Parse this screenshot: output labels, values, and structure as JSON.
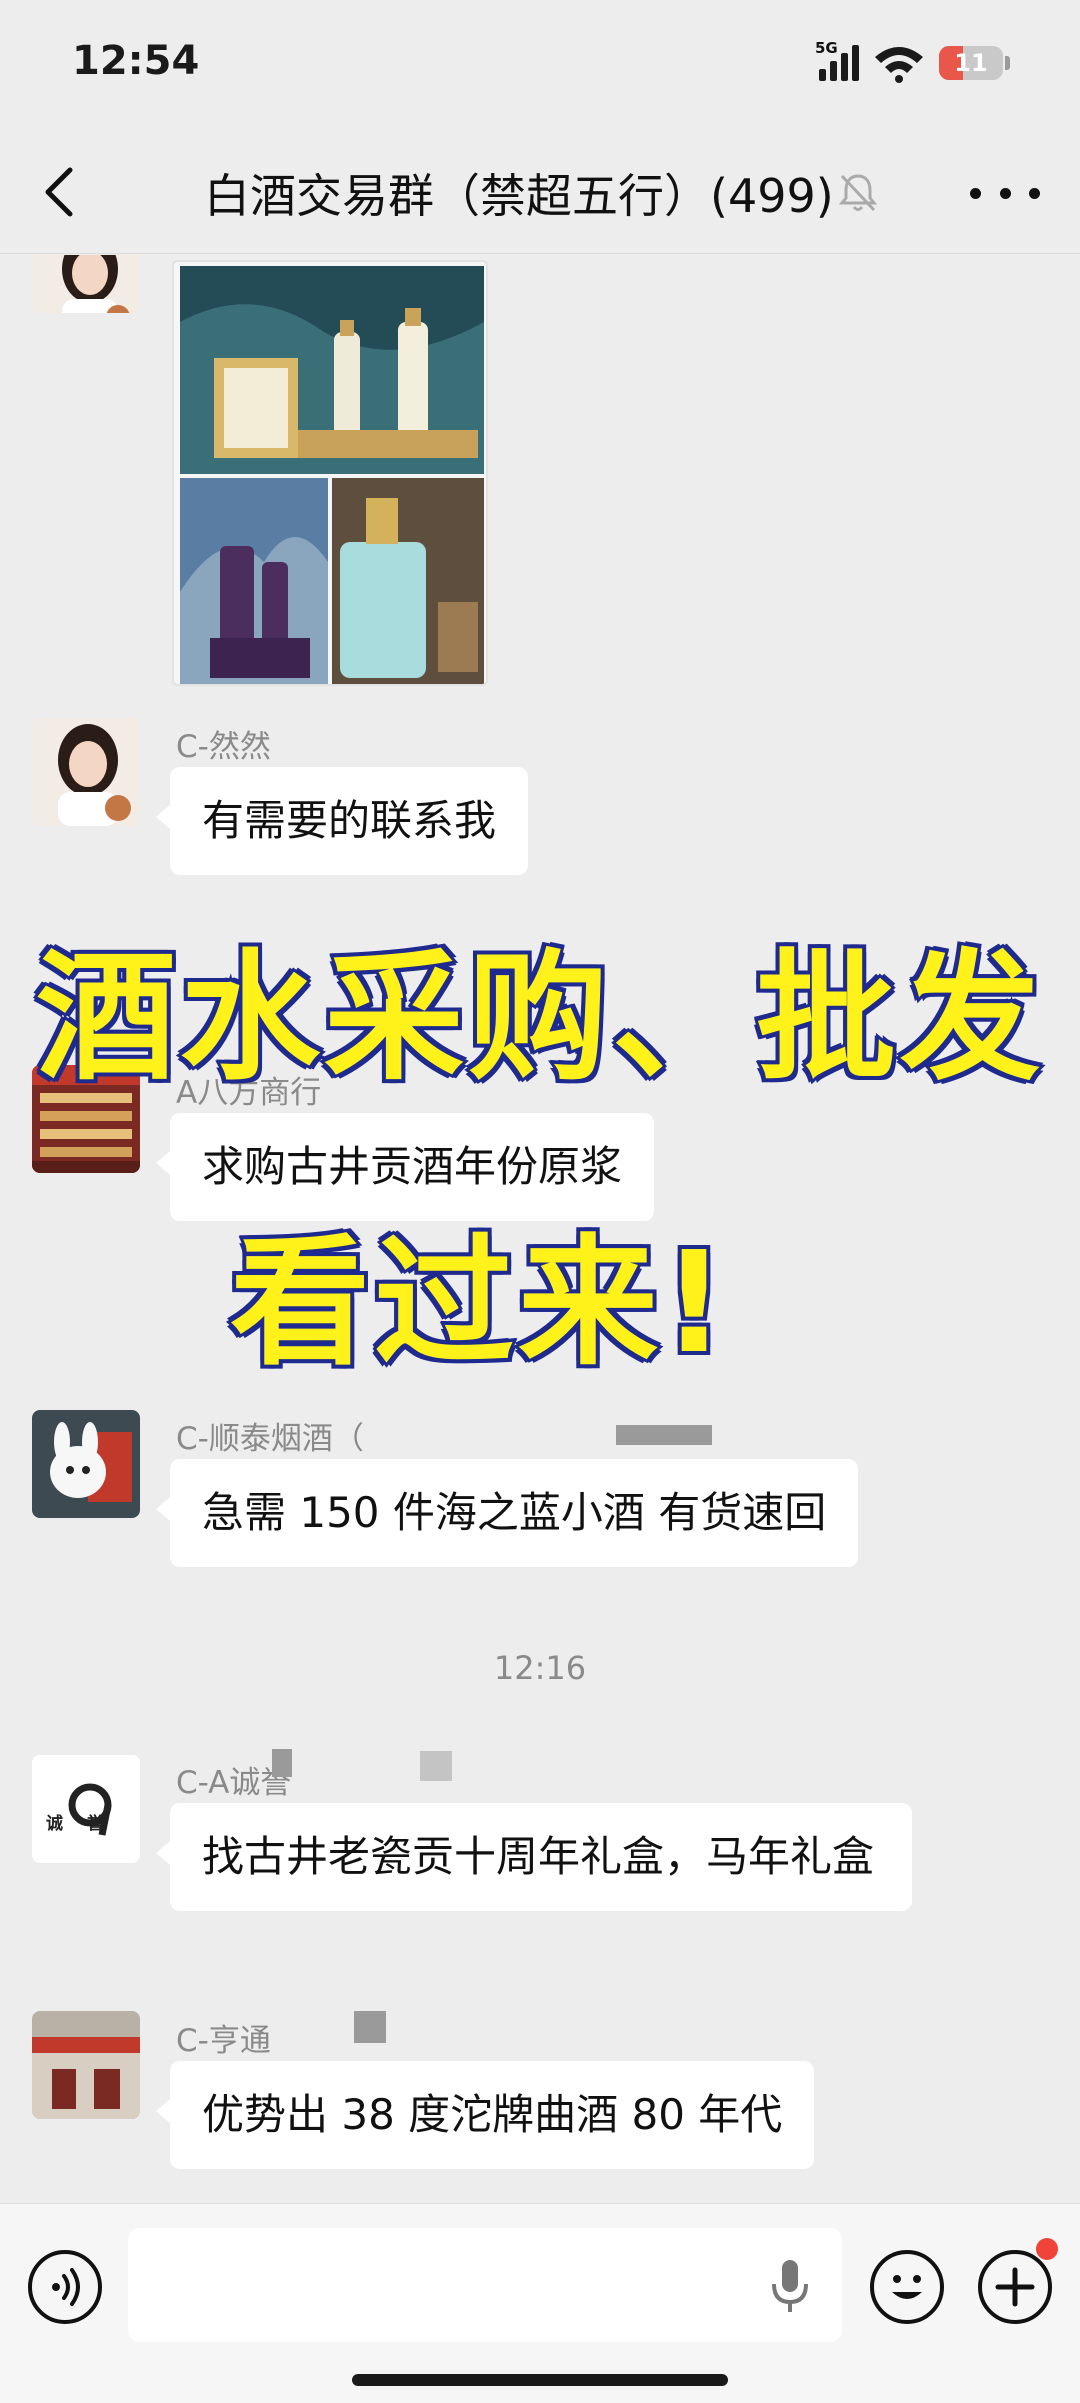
{
  "status": {
    "time": "12:54",
    "network": "5G",
    "battery": "11"
  },
  "header": {
    "title": "白酒交易群（禁超五行）(499)"
  },
  "overlay": {
    "line1": "酒水采购、批发",
    "line2": "看过来!"
  },
  "messages": [
    {
      "sender": "C-然然",
      "text": "有需要的联系我"
    },
    {
      "sender": "A八方商行",
      "text": "求购古井贡酒年份原浆"
    },
    {
      "sender": "C-顺泰烟酒（",
      "text": "急需 150 件海之蓝小酒 有货速回"
    },
    {
      "sender": "C-A诚誉",
      "text": "找古井老瓷贡十周年礼盒，马年礼盒"
    },
    {
      "sender": "C-亨通",
      "text": "优势出 38 度沱牌曲酒 80 年代"
    }
  ],
  "time_divider": "12:16",
  "avatar_badge": "诚誉",
  "colors": {
    "background": "#ededed",
    "bubble": "#ffffff",
    "overlay_fill": "#fff21a",
    "overlay_stroke": "#1f2a8f"
  }
}
